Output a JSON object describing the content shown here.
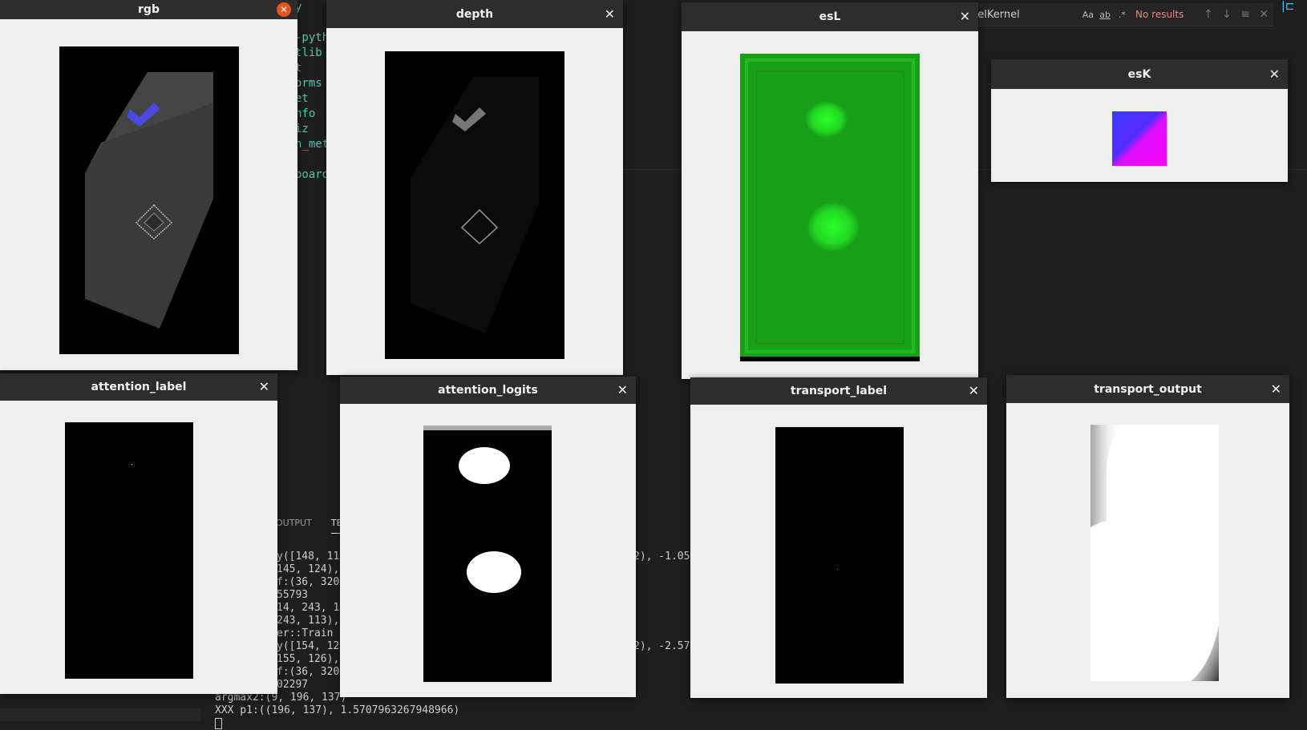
{
  "editor": {
    "code_lines": [
      "y",
      "",
      "-pyth",
      "tlib",
      "t",
      "orms",
      "et",
      "nfo",
      "iz",
      "h_met",
      "",
      "board"
    ]
  },
  "find_widget": {
    "query": "delKernel",
    "case_label": "Aa",
    "word_label": "ab",
    "regex_label": ".*",
    "result_text": "No results"
  },
  "panel": {
    "tabs": [
      "OUTPUT",
      "TE"
    ]
  },
  "terminal": {
    "lines": [
      "y([148, 11",
      "145, 124),",
      "f:(36, 320",
      "55793",
      "14, 243, 1",
      "243, 113),",
      "er::Train",
      "y([154, 12",
      "155, 126),",
      "f:(36, 320",
      "02297",
      "argmax2:(9, 196, 137)",
      "XXX p1:((196, 137), 1.5707963267948966)"
    ],
    "right_a": "2), -1.05",
    "right_b": "2), -2.57"
  },
  "windows": {
    "rgb": {
      "title": "rgb"
    },
    "depth": {
      "title": "depth"
    },
    "esL": {
      "title": "esL"
    },
    "esK": {
      "title": "esK"
    },
    "attention_label": {
      "title": "attention_label"
    },
    "attention_logits": {
      "title": "attention_logits"
    },
    "transport_label": {
      "title": "transport_label"
    },
    "transport_output": {
      "title": "transport_output"
    }
  },
  "close_glyph": "✕",
  "colors": {
    "titlebar": "#2d2d2d",
    "window_bg": "#efefef",
    "focused_close": "#e9541e",
    "esL_green": "#1aa71a",
    "accent_blue": "#4949e0",
    "magenta": "#ff00ff"
  }
}
